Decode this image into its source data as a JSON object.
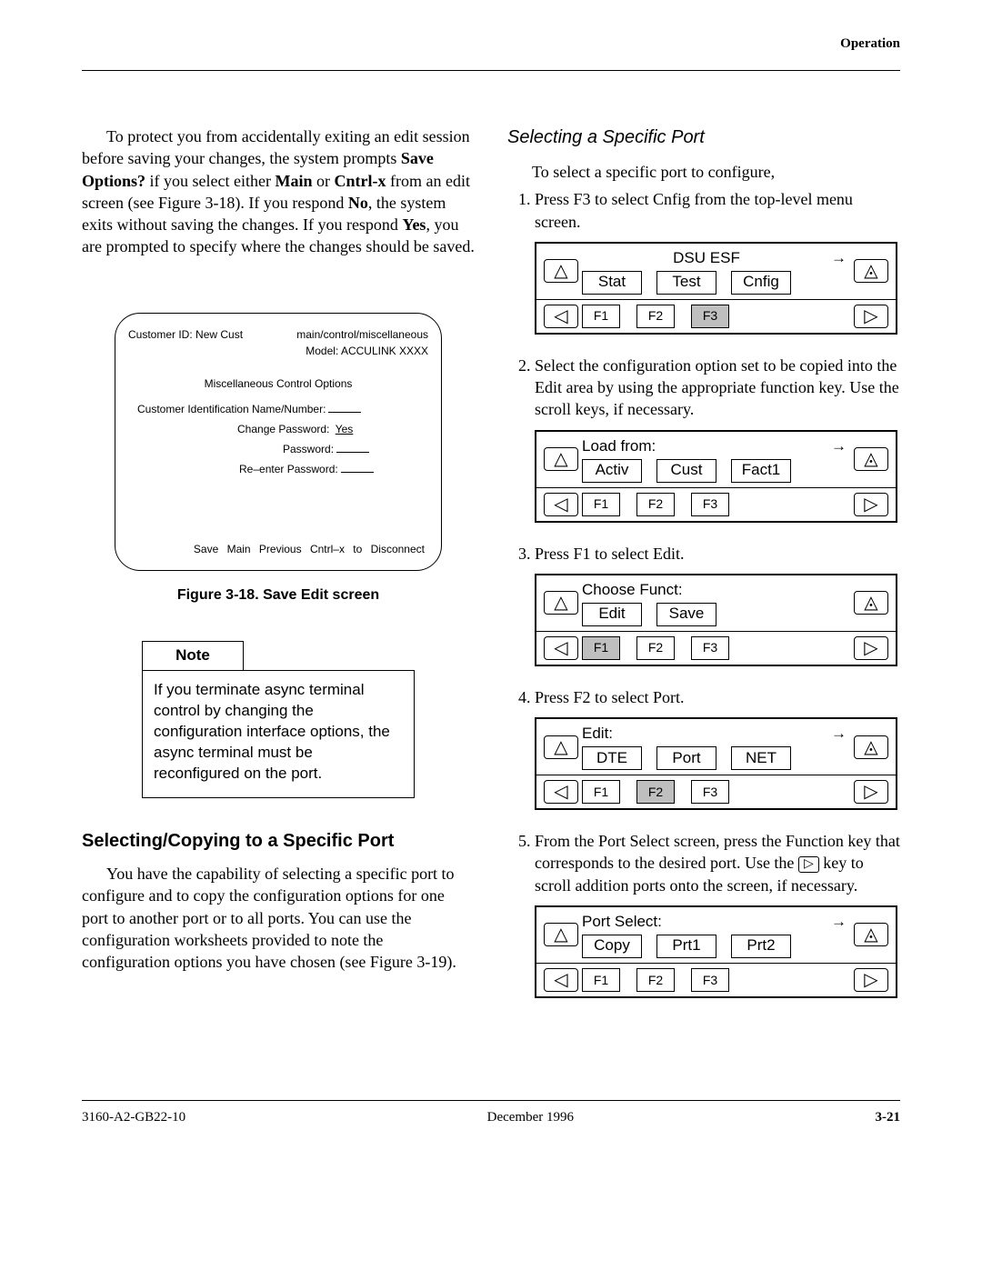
{
  "header": {
    "section": "Operation"
  },
  "left": {
    "para1_pre": "To protect you from accidentally exiting an edit session before saving your changes, the system prompts ",
    "para1_b1": "Save Options?",
    "para1_mid1": " if you select either ",
    "para1_b2": "Main",
    "para1_mid2": " or ",
    "para1_b3": "Cntrl-x",
    "para1_mid3": " from an edit screen (see Figure 3-18). If you respond ",
    "para1_b4": "No",
    "para1_mid4": ", the system exits without saving the changes. If you respond ",
    "para1_b5": "Yes",
    "para1_post": ", you are prompted to specify where the changes should be saved.",
    "term": {
      "path": "main/control/miscellaneous",
      "cust_id_label": "Customer ID:",
      "cust_id_value": "New Cust",
      "model_label": "Model:",
      "model_value": "ACCULINK XXXX",
      "section_title": "Miscellaneous Control Options",
      "line1": "Customer Identification Name/Number:",
      "line2_label": "Change Password:",
      "line2_value": "Yes",
      "line3": "Password:",
      "line4": "Re–enter Password:",
      "footer": "Save   Main   Previous   Cntrl–x to Disconnect"
    },
    "fig_caption": "Figure 3-18.  Save Edit screen",
    "note_title": "Note",
    "note_body": "If you terminate async terminal control by changing the configuration interface options, the async terminal must be reconfigured on the port.",
    "h2": "Selecting/Copying to a Specific Port",
    "para2": "You have the capability of selecting a specific port to configure and to copy the configuration options for one port to another port or to all ports. You can use the configuration worksheets provided to note the configuration options you have chosen (see Figure 3-19)."
  },
  "right": {
    "h3": "Selecting a Specific Port",
    "intro": "To select a specific port to configure,",
    "steps": {
      "s1": "Press F3 to select Cnfig from the top-level menu screen.",
      "s2": "Select the configuration option set to be copied into the Edit area by using the appropriate function key. Use the scroll keys, if necessary.",
      "s3": "Press F1 to select Edit.",
      "s4": "Press F2 to select Port.",
      "s5_pre": "From the Port Select screen, press the Function key that corresponds to the desired port. Use the ",
      "s5_post": " key to scroll addition ports onto the screen, if necessary."
    },
    "lcds": {
      "dsuesf": {
        "title": "DSU ESF",
        "opts": [
          "Stat",
          "Test",
          "Cnfig"
        ],
        "sel_fkey": "F3"
      },
      "loadfrom": {
        "title": "Load from:",
        "opts": [
          "Activ",
          "Cust",
          "Fact1"
        ],
        "sel_fkey": ""
      },
      "choose": {
        "title": "Choose Funct:",
        "opts": [
          "Edit",
          "Save",
          ""
        ],
        "sel_fkey": "F1"
      },
      "edit": {
        "title": "Edit:",
        "opts": [
          "DTE",
          "Port",
          "NET"
        ],
        "sel_fkey": "F2"
      },
      "portsel": {
        "title": "Port Select:",
        "opts": [
          "Copy",
          "Prt1",
          "Prt2"
        ],
        "sel_fkey": ""
      }
    }
  },
  "glyphs": {
    "tri_up": "△",
    "tri_up_line": "◬",
    "tri_left": "◁",
    "tri_right": "▷",
    "arrow_r": "→"
  },
  "fkeys": [
    "F1",
    "F2",
    "F3"
  ],
  "footer": {
    "left": "3160-A2-GB22-10",
    "center": "December 1996",
    "right": "3-21"
  }
}
